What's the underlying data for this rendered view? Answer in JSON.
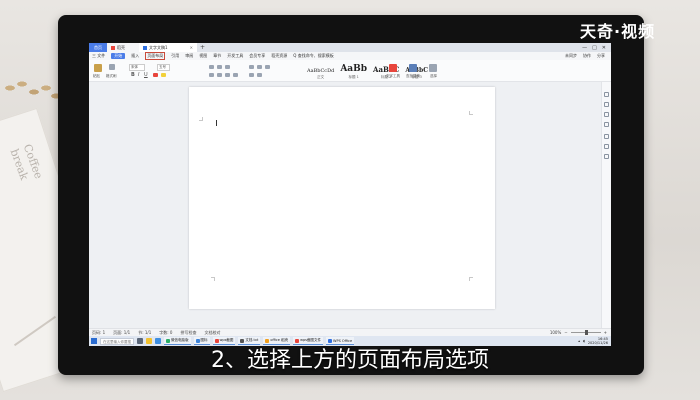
{
  "watermark": "天奇·视频",
  "subtitle": "2、选择上方的页面布局选项",
  "background_text": "Coffee\nbreak",
  "wps": {
    "tabs": [
      {
        "label": "首页",
        "color": "#4a7ce8"
      },
      {
        "label": "稻壳",
        "color": "#e8453c"
      },
      {
        "label": "文字文稿1",
        "color": "#2f6fe0"
      }
    ],
    "new_tab": "+",
    "window_controls": [
      "—",
      "□",
      "✕"
    ],
    "menu": [
      "三 文件",
      "开始",
      "插入",
      "页面布局",
      "引用",
      "审阅",
      "视图",
      "章节",
      "开发工具",
      "会员专享",
      "稻壳资源"
    ],
    "menu_search": "Q 查找命令、搜索模板",
    "menu_right": [
      "未同步",
      "协作",
      "分享"
    ],
    "ribbon": {
      "paste": "粘贴",
      "format_painter": "格式刷",
      "font_name": "宋体",
      "font_size": "五号",
      "styles": [
        {
          "sample": "AaBbCcDd",
          "name": "正文",
          "size": 5
        },
        {
          "sample": "AaBb",
          "name": "标题 1",
          "size": 9
        },
        {
          "sample": "AaBbC",
          "name": "标题 2",
          "size": 7
        },
        {
          "sample": "AaBbC",
          "name": "标题 3",
          "size": 6
        }
      ],
      "text_tools": "文字工具",
      "find_replace": "查找替换",
      "select": "选择"
    },
    "status": {
      "page": "页码: 1",
      "pages": "页面: 1/1",
      "section": "节: 1/1",
      "words": "字数: 0",
      "spell": "拼写检查",
      "doc_check": "文档校对",
      "zoom": "100%"
    },
    "taskbar": {
      "search": "在这里输入你要搜索的内容",
      "apps": [
        {
          "label": "微信电脑版",
          "color": "#2aae67"
        },
        {
          "label": "图标",
          "color": "#3b82d8"
        },
        {
          "label": "wps截图",
          "color": "#e8453c"
        },
        {
          "label": "文档.txt",
          "color": "#555555"
        },
        {
          "label": "office 稻壳",
          "color": "#f0a020"
        },
        {
          "label": "wps截图文件",
          "color": "#e8453c"
        },
        {
          "label": "WPS Office",
          "color": "#2f6fe0"
        },
        {
          "label": "文字文稿1",
          "color": "#2f6fe0"
        }
      ],
      "time": "16:45",
      "date": "2020/11/26"
    }
  }
}
